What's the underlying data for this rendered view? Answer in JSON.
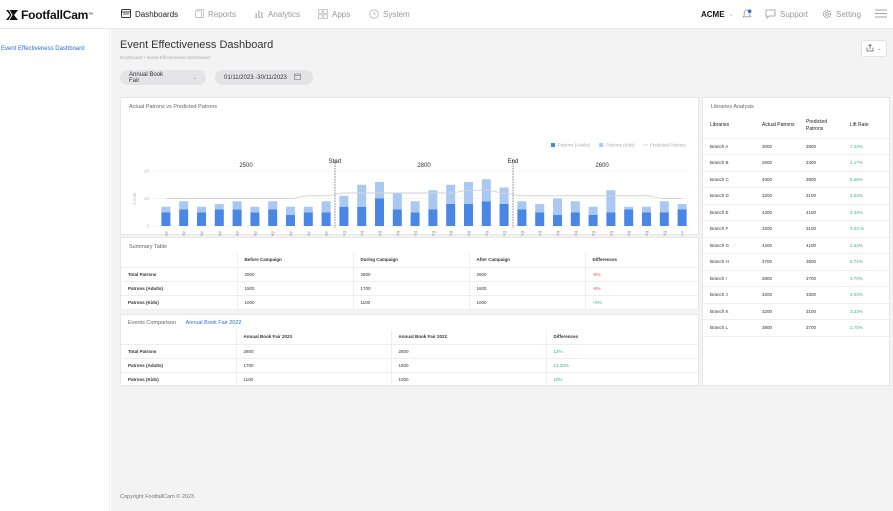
{
  "brand": {
    "name": "FootfallCam",
    "tm": "™"
  },
  "nav": {
    "items": [
      {
        "label": "Dashboards",
        "icon": "dashboard-icon"
      },
      {
        "label": "Reports",
        "icon": "reports-icon"
      },
      {
        "label": "Analytics",
        "icon": "analytics-icon"
      },
      {
        "label": "Apps",
        "icon": "apps-icon"
      },
      {
        "label": "System",
        "icon": "system-icon"
      }
    ],
    "account": "ACME",
    "support": "Support",
    "setting": "Setting"
  },
  "sidebar": {
    "items": [
      {
        "label": "Event Effectiveness Dashboard"
      }
    ]
  },
  "page": {
    "title": "Event Effectiveness Dashboard",
    "breadcrumb": "Dashboard > Event Effectiveness Dashboard",
    "event_select": "Annual Book Fair",
    "date_range": "01/11/2023 -30/11/2023"
  },
  "chart_data": {
    "type": "bar",
    "title": "Actual Patrons vs Predicted Patrons",
    "ylabel": "Count",
    "ylim": [
      0,
      20
    ],
    "yticks": [
      0,
      10,
      20
    ],
    "legend_position": "top-right",
    "categories": [
      "21 Sep",
      "22 Sep",
      "23 Sep",
      "24 Sep",
      "25 Sep",
      "26 Sep",
      "27 Sep",
      "28 Sep",
      "29 Sep",
      "30 Sep",
      "01 Aug",
      "02 Aug",
      "03 Aug",
      "04 Aug",
      "05 Aug",
      "06 Aug",
      "07 Aug",
      "08 Aug",
      "09 Aug",
      "10 Aug",
      "11 Aug",
      "12 Aug",
      "13 Aug",
      "14 Aug",
      "15 Aug",
      "16 Aug",
      "17 Aug",
      "18 Aug",
      "19 Aug",
      "20 Nov"
    ],
    "series": [
      {
        "name": "Patrons (Adults)",
        "color": "#4a87e4",
        "stack": "patrons",
        "values": [
          5,
          6,
          5,
          6,
          6,
          5,
          6,
          4,
          5,
          5,
          7,
          7,
          10,
          6,
          5,
          6,
          8,
          8,
          9,
          8,
          6,
          5,
          4,
          5,
          4,
          5,
          6,
          5,
          5,
          6
        ]
      },
      {
        "name": "Patrons (Kids)",
        "color": "#a9c9f0",
        "stack": "patrons",
        "values": [
          2,
          3,
          2,
          2,
          3,
          2,
          3,
          3,
          2,
          4,
          4,
          8,
          6,
          6,
          4,
          7,
          7,
          8,
          8,
          6,
          3,
          3,
          6,
          4,
          3,
          8,
          1,
          2,
          4,
          2
        ]
      },
      {
        "name": "Predicted Patrons",
        "color": "#d2d2d8",
        "type": "line",
        "values": [
          10,
          10,
          10,
          10,
          10,
          10,
          10,
          10,
          11,
          11,
          12,
          12,
          12,
          12,
          12,
          12,
          12,
          13,
          13,
          12,
          11,
          11,
          11,
          11,
          11,
          11,
          11,
          11,
          10,
          10
        ]
      }
    ],
    "phases": [
      {
        "label": "2500"
      },
      {
        "label": "2800"
      },
      {
        "label": "2600"
      }
    ],
    "markers": [
      {
        "label": "Start",
        "after_category": "30 Sep"
      },
      {
        "label": "End",
        "after_category": "10 Aug"
      }
    ]
  },
  "summary": {
    "title": "Summary Table",
    "headers": [
      "",
      "Before Campaign",
      "During Campaign",
      "After Campaign",
      "Differences"
    ],
    "rows": [
      {
        "label": "Total Patrons",
        "cells": [
          "2500",
          "2800",
          "2600",
          "-8%"
        ],
        "diff_sign": "neg"
      },
      {
        "label": "Patrons (Adults)",
        "cells": [
          "1500",
          "1700",
          "1600",
          "-6%"
        ],
        "diff_sign": "neg"
      },
      {
        "label": "Patrons (Kids)",
        "cells": [
          "1000",
          "1100",
          "1000",
          "+0%"
        ],
        "diff_sign": "pos"
      }
    ]
  },
  "events": {
    "title": "Events Comparison",
    "compare_link": "Annual Book Fair 2022",
    "headers": [
      "",
      "Annual Book Fair 2023",
      "Annual Book Fair 2022",
      "Differences"
    ],
    "rows": [
      {
        "label": "Total Patrons",
        "cells": [
          "2800",
          "2500",
          "12%"
        ]
      },
      {
        "label": "Patrons (Adults)",
        "cells": [
          "1700",
          "1500",
          "13.33%"
        ]
      },
      {
        "label": "Patrons (Kids)",
        "cells": [
          "1100",
          "1000",
          "10%"
        ]
      }
    ]
  },
  "libraries": {
    "title": "Libraries Analysis",
    "headers": [
      "Libraries",
      "Actual Patrons",
      "Predicted Patrons",
      "Lift Rate"
    ],
    "rows": [
      [
        "Branch A",
        "3000",
        "2800",
        "7.14%"
      ],
      [
        "Branch B",
        "2500",
        "2400",
        "4.17%"
      ],
      [
        "Branch C",
        "4000",
        "3800",
        "5.26%"
      ],
      [
        "Branch D",
        "3200",
        "3100",
        "3.23%"
      ],
      [
        "Branch E",
        "4200",
        "4100",
        "2.44%"
      ],
      [
        "Branch F",
        "3200",
        "3100",
        "3.23 %"
      ],
      [
        "Branch G",
        "4200",
        "4100",
        "2.44%"
      ],
      [
        "Branch H",
        "3700",
        "3500",
        "5.71%"
      ],
      [
        "Branch I",
        "2800",
        "2700",
        "3.70%"
      ],
      [
        "Branch J",
        "3200",
        "3300",
        "3.03%"
      ],
      [
        "Branch K",
        "3200",
        "3100",
        "3.23%"
      ],
      [
        "Branch L",
        "3800",
        "3700",
        "2.70%"
      ]
    ]
  },
  "footer": {
    "text": "Copyright FootfallCam © 2023"
  },
  "colors": {
    "accent": "#2b6ed8",
    "positive": "#36b37e",
    "negative": "#e5534b"
  }
}
